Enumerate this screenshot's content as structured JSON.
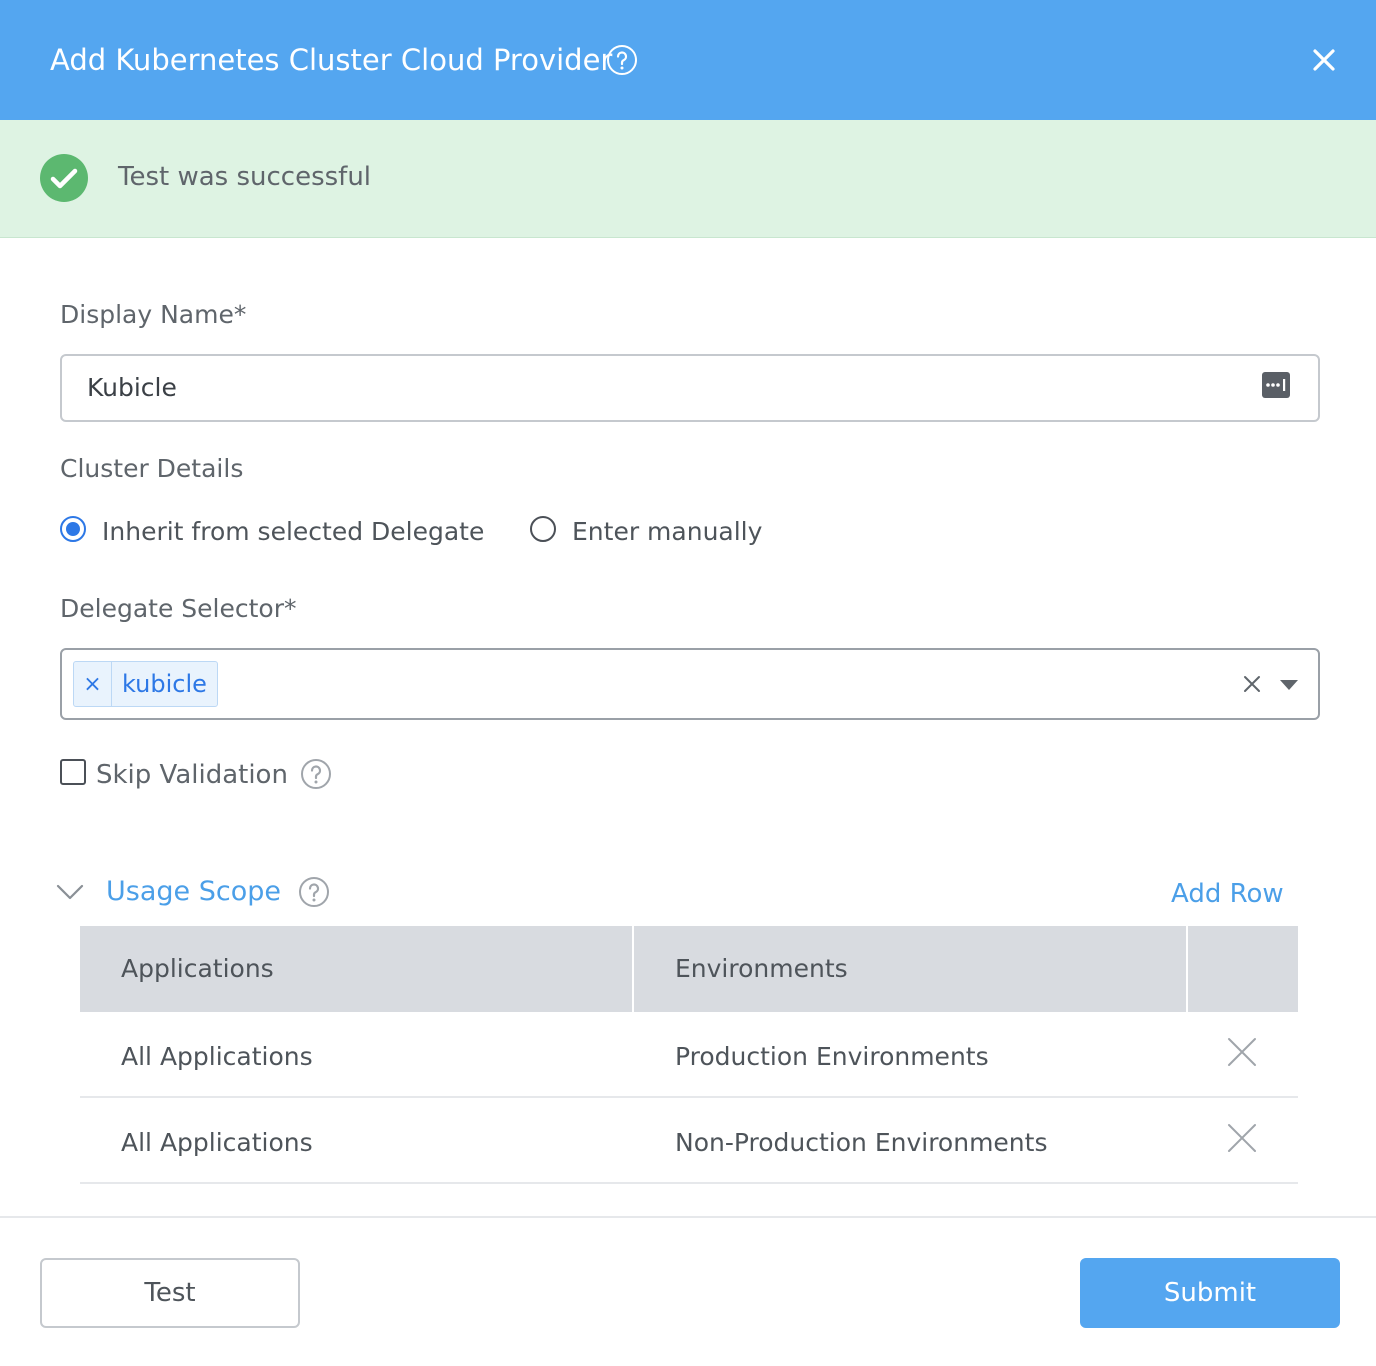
{
  "dialog": {
    "title": "Add Kubernetes Cluster Cloud Provider",
    "accent_color": "#54a6f0"
  },
  "banner": {
    "message": "Test was successful",
    "status_color": "#5cb870"
  },
  "display_name": {
    "label": "Display Name*",
    "value": "Kubicle"
  },
  "cluster_details": {
    "label": "Cluster Details",
    "options": [
      {
        "label": "Inherit from selected Delegate",
        "selected": true
      },
      {
        "label": "Enter manually",
        "selected": false
      }
    ]
  },
  "delegate_selector": {
    "label": "Delegate Selector*",
    "tags": [
      "kubicle"
    ],
    "tag_remove_glyph": "×"
  },
  "skip_validation": {
    "label": "Skip Validation",
    "checked": false
  },
  "usage_scope": {
    "title": "Usage Scope",
    "add_row_label": "Add Row",
    "columns": [
      "Applications",
      "Environments"
    ],
    "rows": [
      {
        "application": "All Applications",
        "environment": "Production Environments"
      },
      {
        "application": "All Applications",
        "environment": "Non-Production Environments"
      }
    ]
  },
  "footer": {
    "test_label": "Test",
    "submit_label": "Submit"
  }
}
